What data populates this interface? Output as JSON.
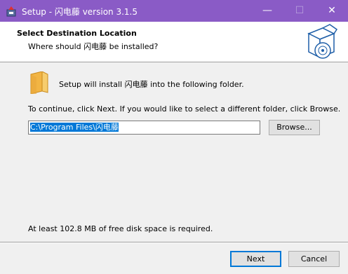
{
  "window": {
    "title": "Setup - 闪电藤 version 3.1.5",
    "minimize_glyph": "—",
    "maximize_glyph": "☐",
    "close_glyph": "✕"
  },
  "header": {
    "title": "Select Destination Location",
    "subtitle": "Where should 闪电藤 be installed?"
  },
  "body": {
    "install_text": "Setup will install 闪电藤 into the following folder.",
    "continue_text": "To continue, click Next. If you would like to select a different folder, click Browse.",
    "path_value": "C:\\Program Files\\闪电藤",
    "browse_label": "Browse...",
    "space_text": "At least 102.8 MB of free disk space is required."
  },
  "footer": {
    "next_label": "Next",
    "cancel_label": "Cancel"
  },
  "colors": {
    "titlebar": "#8a5bc6",
    "accent": "#0078d7"
  }
}
